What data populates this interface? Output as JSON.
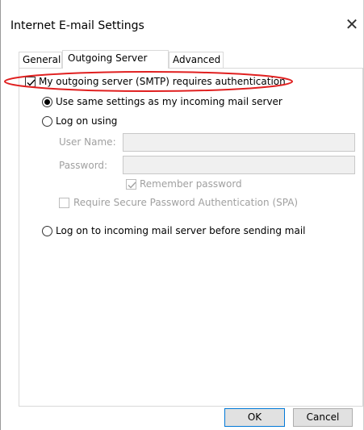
{
  "window": {
    "title": "Internet E-mail Settings",
    "close_glyph": "✕"
  },
  "tabs": [
    {
      "label": "General",
      "active": false
    },
    {
      "label": "Outgoing Server",
      "active": true
    },
    {
      "label": "Advanced",
      "active": false
    }
  ],
  "outgoing": {
    "requires_auth_label": "My outgoing server (SMTP) requires authentication",
    "requires_auth_checked": true,
    "use_same_label": "Use same settings as my incoming mail server",
    "log_on_using_label": "Log on using",
    "user_name_label": "User Name:",
    "user_name_value": "",
    "password_label": "Password:",
    "password_value": "",
    "remember_password_label": "Remember password",
    "remember_password_checked": true,
    "spa_label": "Require Secure Password Authentication (SPA)",
    "spa_checked": false,
    "log_on_incoming_label": "Log on to incoming mail server before sending mail",
    "selected_option": "use_same"
  },
  "buttons": {
    "ok_label": "OK",
    "cancel_label": "Cancel"
  },
  "colors": {
    "annotation_red": "#e02020",
    "ok_border": "#0078d7"
  }
}
